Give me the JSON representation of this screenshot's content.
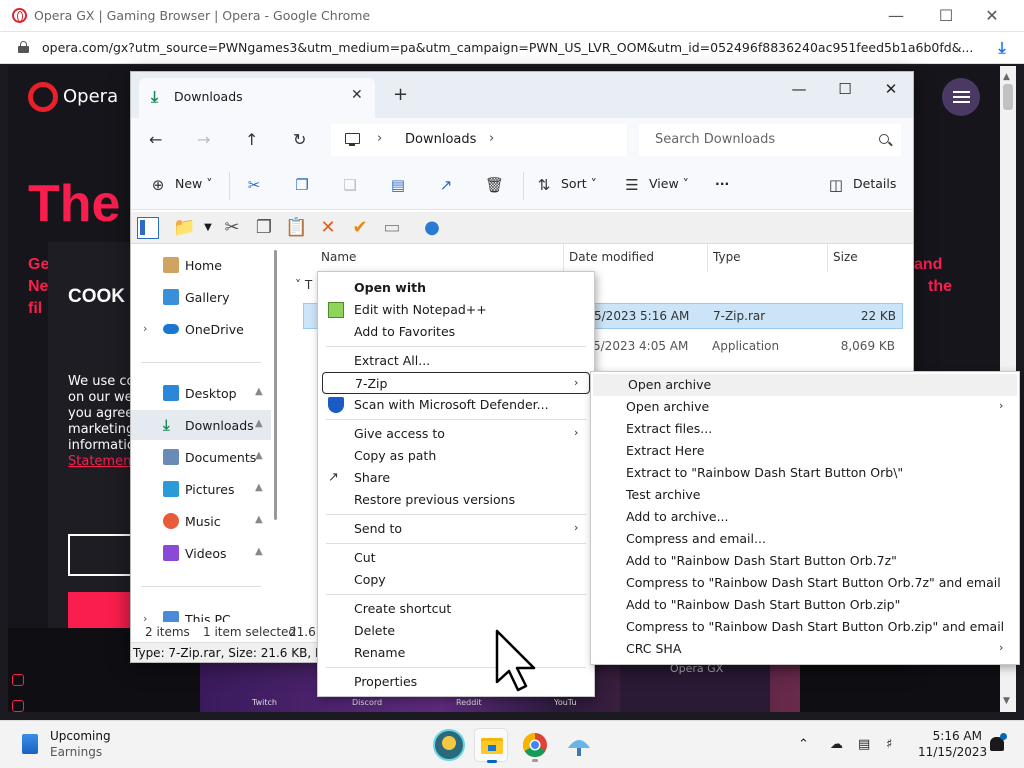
{
  "chrome": {
    "title": "Opera GX | Gaming Browser | Opera - Google Chrome",
    "url": "opera.com/gx?utm_source=PWNgames3&utm_medium=pa&utm_campaign=PWN_US_LVR_OOM&utm_id=052496f8836240ac951feed5b1a6b0fd&...",
    "icons": {
      "lock": "lock-icon",
      "download": "download-icon"
    }
  },
  "opera_page": {
    "logo_text": "Opera",
    "hero": "The",
    "hero_lines": [
      "Ge",
      "Ne",
      "fil"
    ],
    "hero_right": [
      "and",
      "the"
    ],
    "cookie_title": "COOK",
    "cookie_lines": [
      "We use co",
      "on our we",
      "you agree",
      "marketing",
      "informatio"
    ],
    "cookie_link": "Statemen",
    "thumb_labels": [
      "Twitch",
      "Discord",
      "Reddit",
      "YouTu"
    ],
    "gx_label": "Opera GX"
  },
  "explorer": {
    "tab_label": "Downloads",
    "breadcrumb": "Downloads",
    "search_placeholder": "Search Downloads",
    "commands": {
      "new": "New",
      "sort": "Sort",
      "view": "View",
      "details": "Details",
      "more": "···"
    },
    "sidebar": [
      {
        "label": "Home",
        "icon": "home-icon"
      },
      {
        "label": "Gallery",
        "icon": "gallery-icon"
      },
      {
        "label": "OneDrive",
        "icon": "cloud-icon"
      },
      {
        "label": "Desktop",
        "icon": "desktop-icon"
      },
      {
        "label": "Downloads",
        "icon": "download-icon"
      },
      {
        "label": "Documents",
        "icon": "documents-icon"
      },
      {
        "label": "Pictures",
        "icon": "pictures-icon"
      },
      {
        "label": "Music",
        "icon": "music-icon"
      },
      {
        "label": "Videos",
        "icon": "videos-icon"
      },
      {
        "label": "This PC",
        "icon": "computer-icon"
      }
    ],
    "columns": [
      "Name",
      "Date modified",
      "Type",
      "Size"
    ],
    "group_header": "T",
    "files": [
      {
        "date": "5/2023 5:16 AM",
        "type": "7-Zip.rar",
        "size": "22 KB"
      },
      {
        "date": "5/2023 4:05 AM",
        "type": "Application",
        "size": "8,069 KB"
      }
    ],
    "status": {
      "items": "2 items",
      "selected": "1 item selected",
      "size": "21.6 K"
    },
    "status_detail": "Type: 7-Zip.rar, Size: 21.6 KB, Date m"
  },
  "context_menu": {
    "items": [
      {
        "label": "Open with",
        "bold": true
      },
      {
        "label": "Edit with Notepad++"
      },
      {
        "label": "Add to Favorites"
      },
      {
        "label": "Extract All..."
      },
      {
        "label": "7-Zip",
        "submenu": true
      },
      {
        "label": "Scan with Microsoft Defender..."
      },
      {
        "label": "Give access to",
        "submenu": true
      },
      {
        "label": "Copy as path"
      },
      {
        "label": "Share"
      },
      {
        "label": "Restore previous versions"
      },
      {
        "label": "Send to",
        "submenu": true
      },
      {
        "label": "Cut"
      },
      {
        "label": "Copy"
      },
      {
        "label": "Create shortcut"
      },
      {
        "label": "Delete"
      },
      {
        "label": "Rename"
      },
      {
        "label": "Properties"
      }
    ]
  },
  "zip_submenu": {
    "items": [
      {
        "label": "Open archive"
      },
      {
        "label": "Open archive",
        "submenu": true
      },
      {
        "label": "Extract files..."
      },
      {
        "label": "Extract Here"
      },
      {
        "label": "Extract to \"Rainbow Dash Start Button Orb\\\""
      },
      {
        "label": "Test archive"
      },
      {
        "label": "Add to archive..."
      },
      {
        "label": "Compress and email..."
      },
      {
        "label": "Add to \"Rainbow Dash Start Button Orb.7z\""
      },
      {
        "label": "Compress to \"Rainbow Dash Start Button Orb.7z\" and email"
      },
      {
        "label": "Add to \"Rainbow Dash Start Button Orb.zip\""
      },
      {
        "label": "Compress to \"Rainbow Dash Start Button Orb.zip\" and email"
      },
      {
        "label": "CRC SHA",
        "submenu": true
      }
    ]
  },
  "taskbar": {
    "weather_title": "Upcoming",
    "weather_sub": "Earnings",
    "time": "5:16 AM",
    "date": "11/15/2023"
  },
  "colors": {
    "opera_red": "#fa1e4e",
    "accent": "#0067c0",
    "selection": "#cce4f7"
  }
}
